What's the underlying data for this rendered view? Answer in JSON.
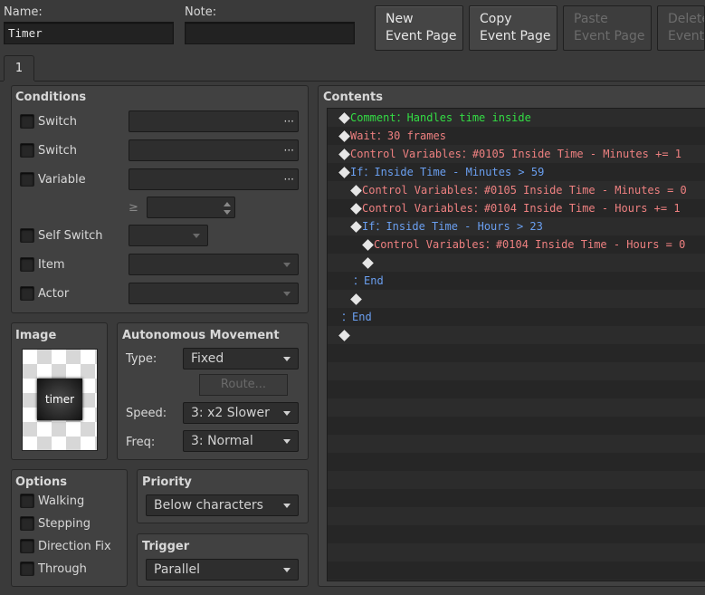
{
  "header": {
    "name_label": "Name:",
    "name_value": "Timer",
    "note_label": "Note:",
    "note_value": "",
    "buttons": {
      "new": [
        "New",
        "Event Page"
      ],
      "copy": [
        "Copy",
        "Event Page"
      ],
      "paste": [
        "Paste",
        "Event Page"
      ],
      "delete": [
        "Delete",
        "Event Page"
      ]
    }
  },
  "tabs": [
    "1"
  ],
  "conditions": {
    "title": "Conditions",
    "switch1_label": "Switch",
    "switch2_label": "Switch",
    "variable_label": "Variable",
    "ellipsis": "···",
    "comparator": "≥",
    "self_switch_label": "Self Switch",
    "item_label": "Item",
    "actor_label": "Actor"
  },
  "image": {
    "title": "Image",
    "sprite_text": "timer"
  },
  "autonomous": {
    "title": "Autonomous Movement",
    "type_label": "Type:",
    "type_value": "Fixed",
    "route_label": "Route...",
    "speed_label": "Speed:",
    "speed_value": "3: x2 Slower",
    "freq_label": "Freq:",
    "freq_value": "3: Normal"
  },
  "options": {
    "title": "Options",
    "walking": "Walking",
    "stepping": "Stepping",
    "direction_fix": "Direction Fix",
    "through": "Through"
  },
  "priority": {
    "title": "Priority",
    "value": "Below characters"
  },
  "trigger": {
    "title": "Trigger",
    "value": "Parallel"
  },
  "contents": {
    "title": "Contents",
    "colors": {
      "comment": "#33dd44",
      "action": "#ee8080",
      "flow": "#6a9ff0"
    },
    "commands": [
      {
        "indent": 0,
        "diamond": true,
        "kind": "comment",
        "text": "Comment：Handles time inside"
      },
      {
        "indent": 0,
        "diamond": true,
        "kind": "action",
        "text": "Wait：30 frames"
      },
      {
        "indent": 0,
        "diamond": true,
        "kind": "action",
        "text": "Control Variables：#0105 Inside Time - Minutes += 1"
      },
      {
        "indent": 0,
        "diamond": true,
        "kind": "flow",
        "text": "If：Inside Time - Minutes > 59"
      },
      {
        "indent": 1,
        "diamond": true,
        "kind": "action",
        "text": "Control Variables：#0105 Inside Time - Minutes = 0"
      },
      {
        "indent": 1,
        "diamond": true,
        "kind": "action",
        "text": "Control Variables：#0104 Inside Time - Hours += 1"
      },
      {
        "indent": 1,
        "diamond": true,
        "kind": "flow",
        "text": "If：Inside Time - Hours > 23"
      },
      {
        "indent": 2,
        "diamond": true,
        "kind": "action",
        "text": "Control Variables：#0104 Inside Time - Hours = 0"
      },
      {
        "indent": 2,
        "diamond": true,
        "kind": "empty",
        "text": ""
      },
      {
        "indent": 1,
        "diamond": false,
        "kind": "flow",
        "text": "：End"
      },
      {
        "indent": 1,
        "diamond": true,
        "kind": "empty",
        "text": ""
      },
      {
        "indent": 0,
        "diamond": false,
        "kind": "flow",
        "text": "：End"
      },
      {
        "indent": 0,
        "diamond": true,
        "kind": "empty",
        "text": ""
      }
    ]
  }
}
